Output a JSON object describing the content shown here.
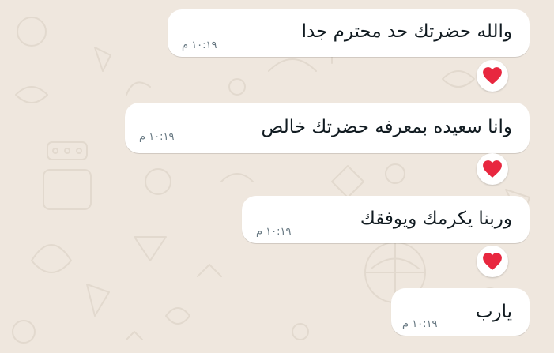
{
  "messages": [
    {
      "text": "والله حضرتك حد محترم جدا",
      "time": "١٠:١٩ م",
      "reaction": "heart-icon"
    },
    {
      "text": "وانا سعيده بمعرفه حضرتك خالص",
      "time": "١٠:١٩ م",
      "reaction": "heart-icon"
    },
    {
      "text": "وربنا يكرمك ويوفقك",
      "time": "١٠:١٩ م",
      "reaction": "heart-icon"
    },
    {
      "text": "يارب",
      "time": "١٠:١٩ م"
    }
  ],
  "colors": {
    "background": "#efe7de",
    "bubble": "#ffffff",
    "text": "#111b21",
    "time": "#667781",
    "heart": "#e8273f"
  }
}
